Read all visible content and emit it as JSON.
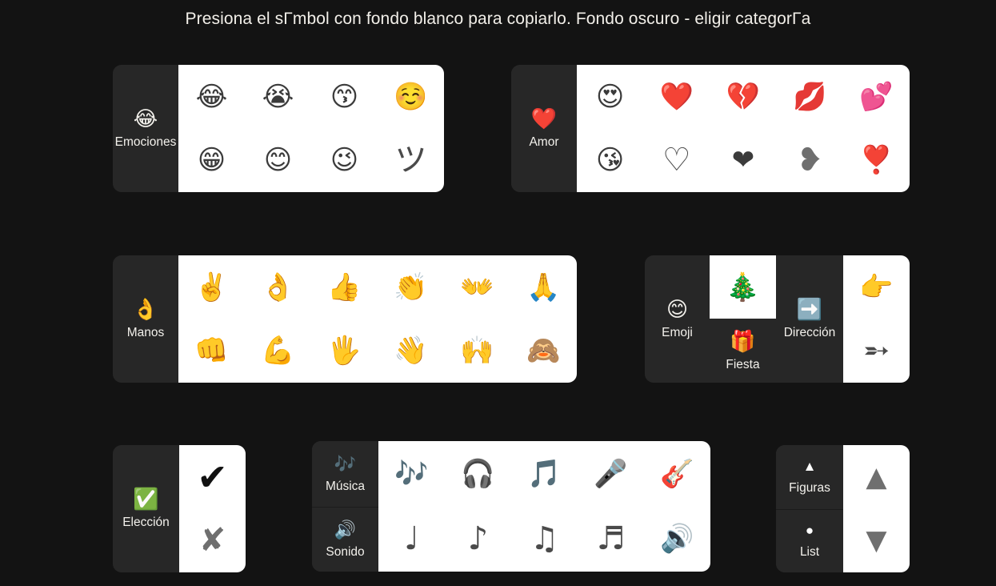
{
  "title": "Presiona el sΓmbol con fondo blanco para copiarlo. Fondo oscuro - eligir categorΓa",
  "colors": {
    "page_background": "#131313",
    "panel_background": "#272727",
    "grid_background": "#ffffff",
    "label_text": "#f3f1ec",
    "title_text": "#f2efe9"
  },
  "cards": [
    {
      "id": "emociones",
      "categories": [
        {
          "label": "Emociones",
          "icon": "😂",
          "icon_name": "face-with-tears-of-joy-icon"
        }
      ],
      "symbols": [
        "😂",
        "😭",
        "😙",
        "☺️",
        "😁",
        "😊",
        "😉",
        "ツ"
      ]
    },
    {
      "id": "amor",
      "categories": [
        {
          "label": "Amor",
          "icon": "❤️",
          "icon_name": "red-heart-icon"
        }
      ],
      "symbols": [
        "😍",
        "❤️",
        "💔",
        "💋",
        "💕",
        "😘",
        "♡",
        "❤",
        "❥",
        "❣️"
      ]
    },
    {
      "id": "manos",
      "categories": [
        {
          "label": "Manos",
          "icon": "👌",
          "icon_name": "ok-hand-icon"
        }
      ],
      "symbols": [
        "✌️",
        "👌",
        "👍",
        "👏",
        "👐",
        "🙏",
        "👊",
        "💪",
        "🖐️",
        "👋",
        "🙌",
        "🙈"
      ]
    },
    {
      "id": "emoji-fiesta-direccion",
      "categories": [
        {
          "label": "Emoji",
          "icon": "😊",
          "icon_name": "smiling-face-icon"
        },
        {
          "label": "Fiesta",
          "icon": "🎁",
          "icon_name": "wrapped-gift-icon"
        },
        {
          "label": "Dirección",
          "icon": "➡️",
          "icon_name": "right-arrow-icon"
        }
      ],
      "fiesta_symbol": "🎄",
      "symbols": [
        "👉",
        "➵"
      ]
    },
    {
      "id": "eleccion",
      "categories": [
        {
          "label": "Elección",
          "icon": "✅",
          "icon_name": "check-mark-button-icon"
        }
      ],
      "symbols": [
        "✔",
        "✘"
      ]
    },
    {
      "id": "musica-sonido",
      "categories": [
        {
          "label": "Música",
          "icon": "🎶",
          "icon_name": "musical-notes-icon"
        },
        {
          "label": "Sonido",
          "icon": "🔊",
          "icon_name": "speaker-high-volume-icon"
        }
      ],
      "symbols": [
        "🎶",
        "🎧",
        "🎵",
        "🎤",
        "🎸",
        "♩",
        "♪",
        "♫",
        "♬",
        "🔊"
      ]
    },
    {
      "id": "figuras-list",
      "categories": [
        {
          "label": "Figuras",
          "icon": "▲",
          "icon_name": "triangle-up-icon"
        },
        {
          "label": "List",
          "icon": "●",
          "icon_name": "filled-circle-icon"
        }
      ],
      "symbols": [
        "▲",
        "▼"
      ]
    }
  ]
}
